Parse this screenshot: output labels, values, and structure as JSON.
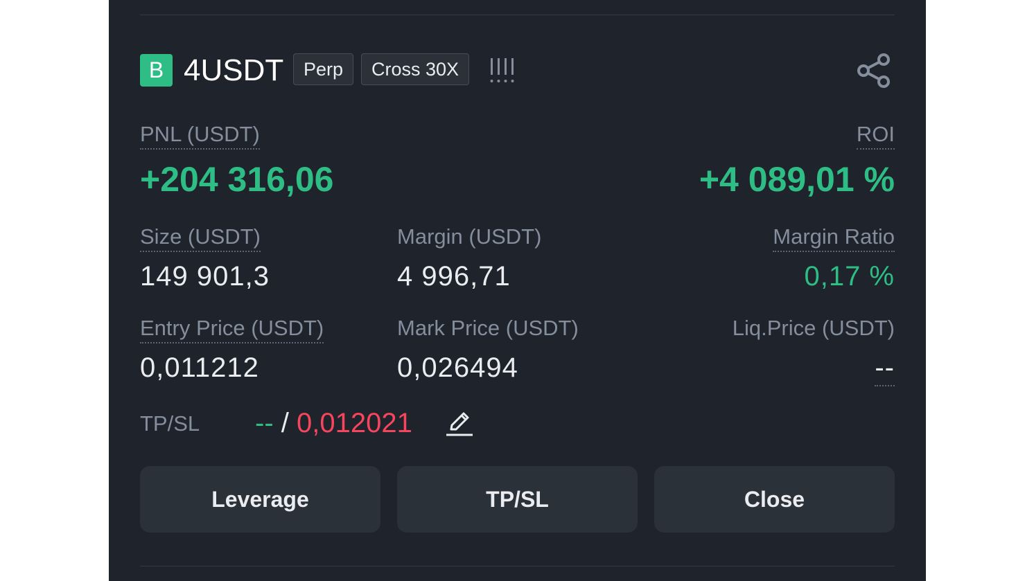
{
  "position": {
    "side_badge": "B",
    "symbol": "4USDT",
    "contract_type": "Perp",
    "margin_mode": "Cross 30X",
    "signal_icon": "signal-bars-icon",
    "share_icon": "share-icon"
  },
  "pnl": {
    "label": "PNL (USDT)",
    "value": "+204 316,06"
  },
  "roi": {
    "label": "ROI",
    "value": "+4 089,01 %"
  },
  "size": {
    "label": "Size (USDT)",
    "value": "149 901,3"
  },
  "margin": {
    "label": "Margin (USDT)",
    "value": "4 996,71"
  },
  "margin_ratio": {
    "label": "Margin Ratio",
    "value": "0,17 %"
  },
  "entry_price": {
    "label": "Entry Price (USDT)",
    "value": "0,011212"
  },
  "mark_price": {
    "label": "Mark Price (USDT)",
    "value": "0,026494"
  },
  "liq_price": {
    "label": "Liq.Price (USDT)",
    "value": "--"
  },
  "tpsl": {
    "label": "TP/SL",
    "tp": "--",
    "separator": "/",
    "sl": "0,012021",
    "edit_icon": "pencil-icon"
  },
  "buttons": {
    "leverage": "Leverage",
    "tpsl": "TP/SL",
    "close": "Close"
  },
  "colors": {
    "positive": "#2ebd85",
    "negative": "#f6465d",
    "background": "#1f232b"
  }
}
